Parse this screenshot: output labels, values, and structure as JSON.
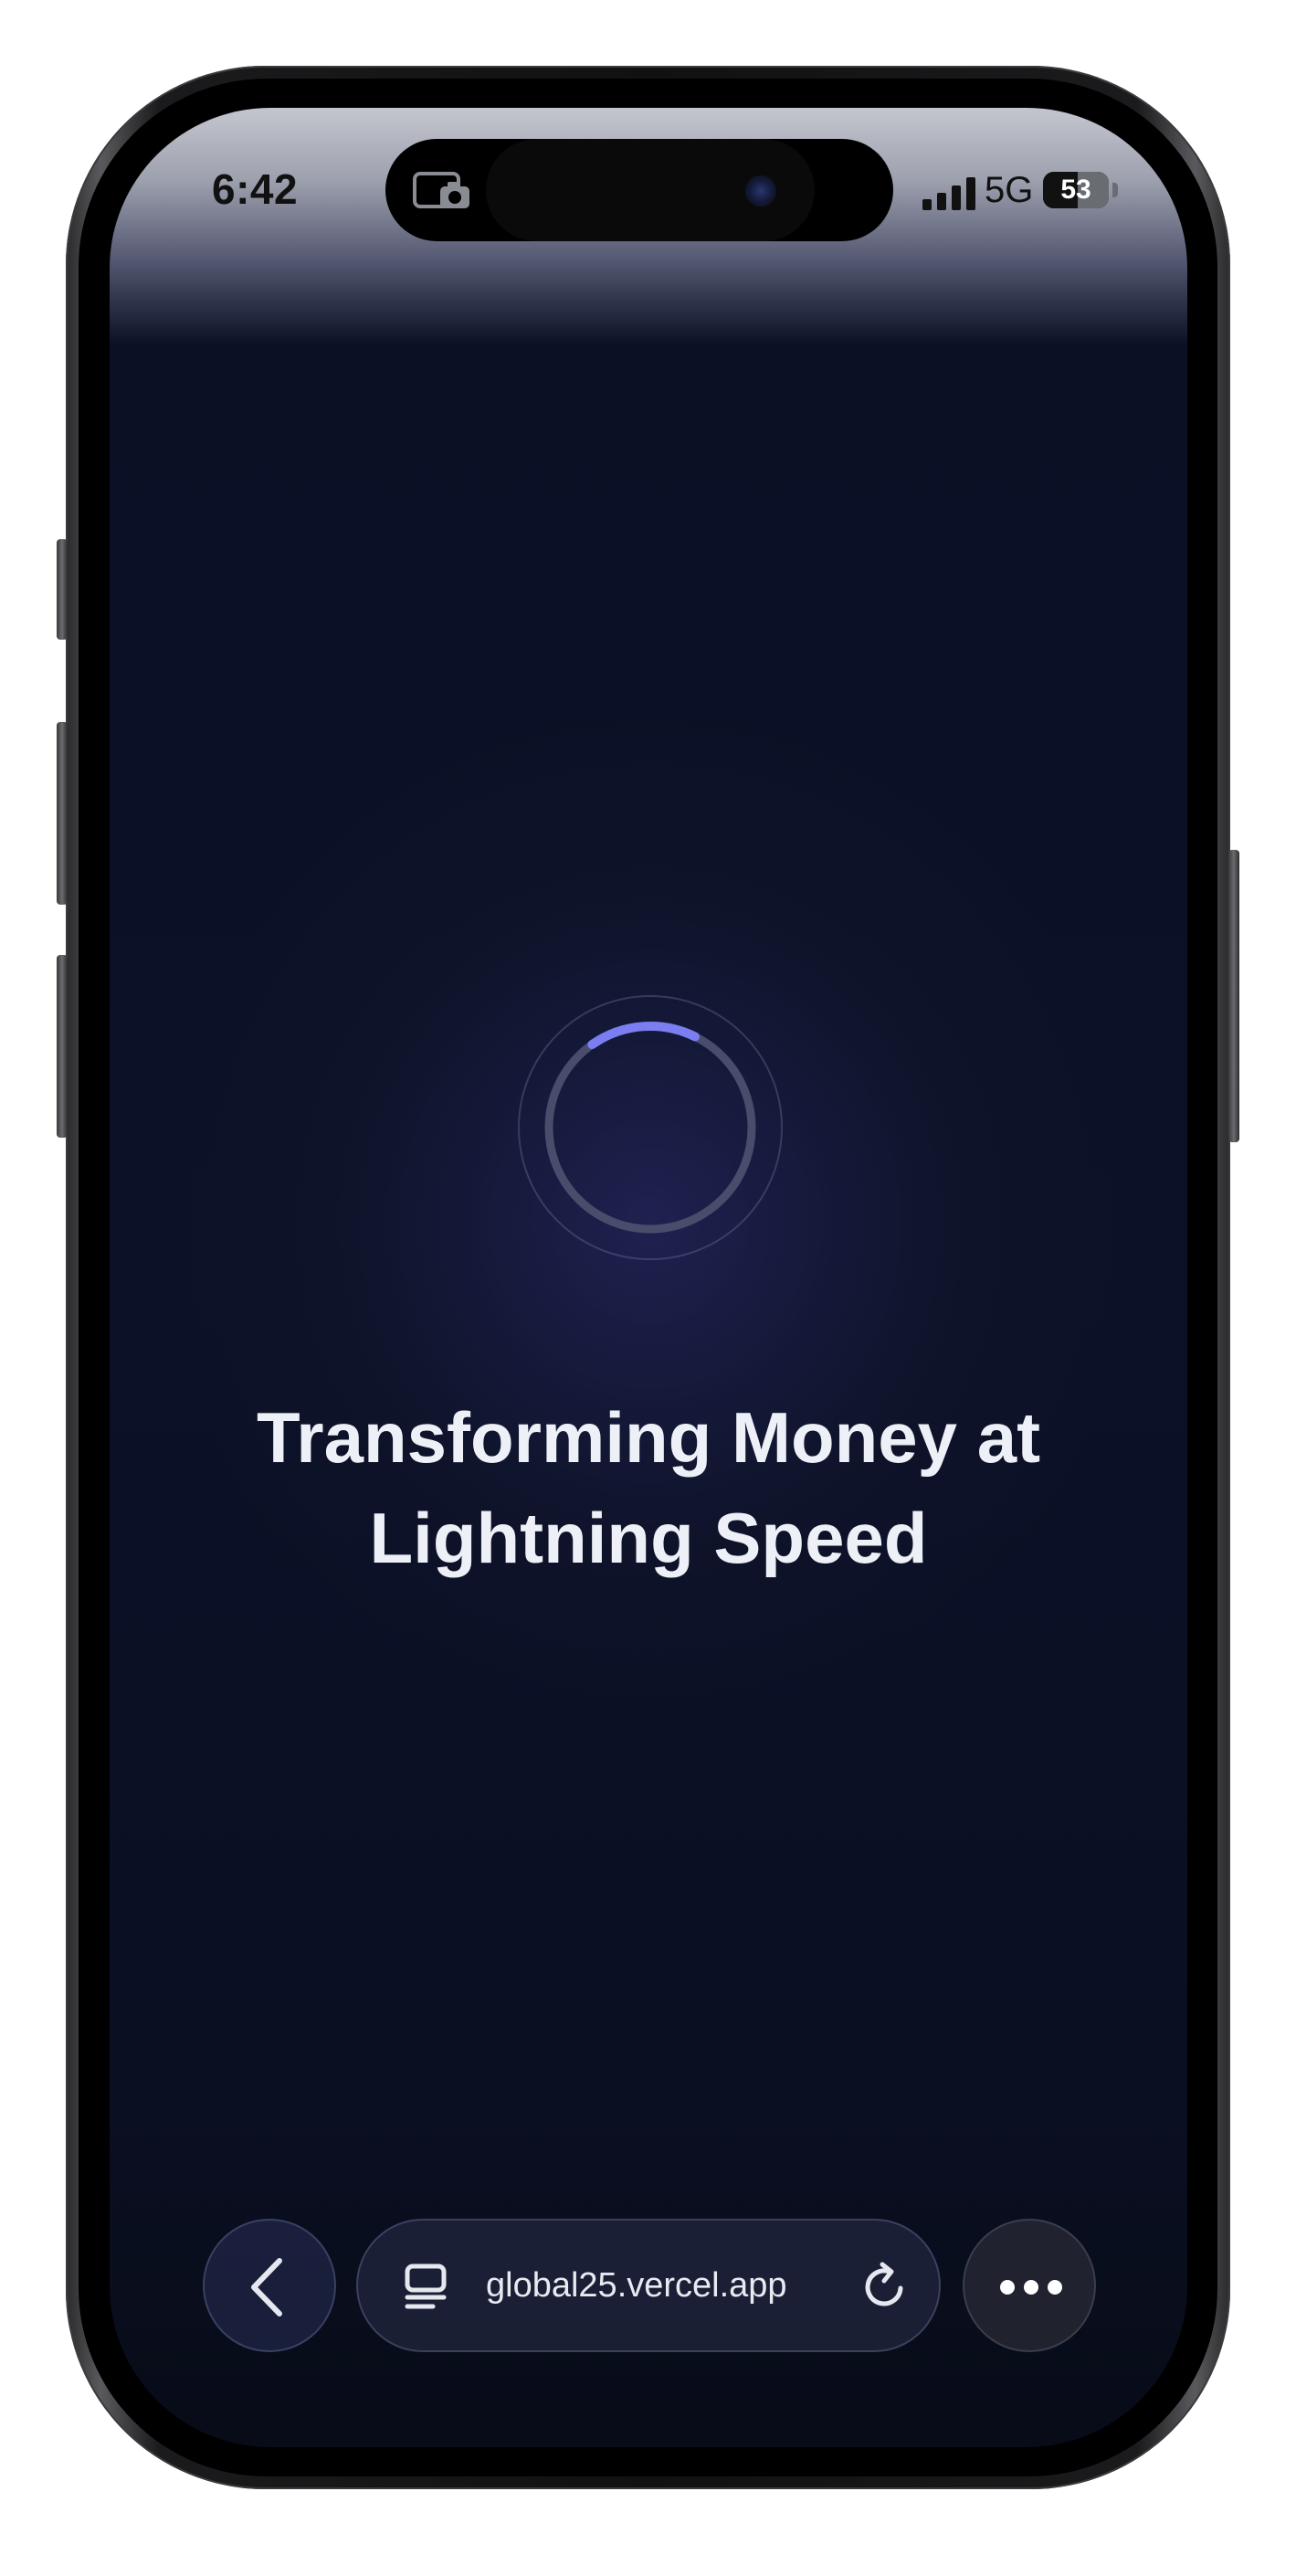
{
  "status_bar": {
    "time": "6:42",
    "network": "5G",
    "battery_percent": "53",
    "battery_level": 0.53,
    "signal_bars": 4
  },
  "loader": {
    "progress": 0.17,
    "track_color": "#4a4c6c",
    "arc_color": "#7a7ef0"
  },
  "main": {
    "headline_line1": "Transforming Money at",
    "headline_line2": "Lightning Speed"
  },
  "browser_bar": {
    "url": "global25.vercel.app",
    "back_icon": "chevron-left-icon",
    "tabs_icon": "tabs-icon",
    "reload_icon": "reload-icon",
    "more_icon": "more-horizontal-icon"
  },
  "colors": {
    "background": "#0c1128",
    "glow": "#1f2150",
    "text": "#eef0f7"
  }
}
